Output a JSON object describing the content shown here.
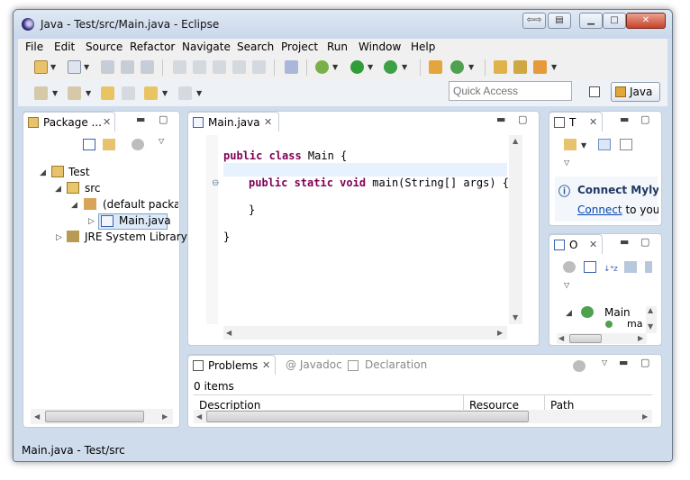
{
  "window": {
    "title": "Java - Test/src/Main.java - Eclipse"
  },
  "menu": [
    "File",
    "Edit",
    "Source",
    "Refactor",
    "Navigate",
    "Search",
    "Project",
    "Run",
    "Window",
    "Help"
  ],
  "toolbar": {
    "quick_access_placeholder": "Quick Access",
    "perspective_label": "Java"
  },
  "package_explorer": {
    "tab_label": "Package ...",
    "tree": {
      "project": "Test",
      "src": "src",
      "package": "(default packa",
      "file": "Main.java",
      "library": "JRE System Library"
    }
  },
  "editor": {
    "tab_label": "Main.java",
    "lines": [
      {
        "kw": "public class",
        "text": " Main {"
      },
      {
        "kw": "public static void",
        "text": " main(String[] args) {"
      },
      {
        "kw": "",
        "text": "}"
      },
      {
        "kw": "",
        "text": "}"
      }
    ]
  },
  "task_list": {
    "tab_label": "T",
    "connect_title": "Connect Mylyn",
    "connect_link": "Connect",
    "connect_suffix": " to your"
  },
  "outline": {
    "tab_label": "O",
    "class_name": "Main",
    "method_name": "ma"
  },
  "problems": {
    "tabs": [
      "Problems",
      "@ Javadoc",
      "Declaration"
    ],
    "count": "0 items",
    "columns": [
      "Description",
      "Resource",
      "Path"
    ]
  },
  "status": {
    "text": "Main.java - Test/src"
  },
  "colors": {
    "keyword": "#7f0055",
    "link": "#0645ad",
    "frame": "#cfdcec"
  }
}
